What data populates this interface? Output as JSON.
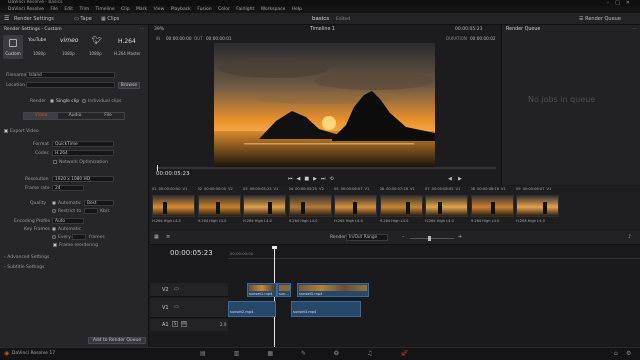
{
  "window": {
    "title": "DaVinci Resolve - basics"
  },
  "menu": [
    "DaVinci Resolve",
    "File",
    "Edit",
    "Trim",
    "Timeline",
    "Clip",
    "Mark",
    "View",
    "Playback",
    "Fusion",
    "Color",
    "Fairlight",
    "Workspace",
    "Help"
  ],
  "toolbar": {
    "render_settings": "Render Settings",
    "tape": "Tape",
    "clips": "Clips",
    "project_name": "basics",
    "project_status": "Edited",
    "render_queue": "Render Queue"
  },
  "render_settings": {
    "header": "Render Settings - Custom",
    "presets": [
      {
        "label": "Custom",
        "brand": ""
      },
      {
        "label": "1080p",
        "brand": "YouTube"
      },
      {
        "label": "1080p",
        "brand": "vimeo"
      },
      {
        "label": "1080p",
        "brand": "twitter"
      },
      {
        "label": "H.264 Master",
        "brand": "H.264"
      }
    ],
    "filename_label": "Filename",
    "filename_value": "Island",
    "location_label": "Location",
    "browse": "Browse",
    "render_label": "Render",
    "single_clip": "Single clip",
    "individual_clips": "Individual clips",
    "tabs": [
      "Video",
      "Audio",
      "File"
    ],
    "export_video": "Export Video",
    "format_label": "Format",
    "format_value": "QuickTime",
    "codec_label": "Codec",
    "codec_value": "H.264",
    "network_opt": "Network Optimization",
    "resolution_label": "Resolution",
    "resolution_value": "1920 x 1080 HD",
    "framerate_label": "Frame rate",
    "framerate_value": "24",
    "quality_label": "Quality",
    "automatic": "Automatic",
    "best": "Best",
    "restrict_to": "Restrict to",
    "kbs": "Kb/s",
    "encoding_profile_label": "Encoding Profile",
    "encoding_profile_value": "Auto",
    "key_frames_label": "Key Frames",
    "key_automatic": "Automatic",
    "every": "Every",
    "frames": "frames",
    "frame_reordering": "Frame reordering",
    "advanced_settings": "Advanced Settings",
    "subtitle_settings": "Subtitle Settings",
    "add_to_queue": "Add to Render Queue"
  },
  "viewer": {
    "zoom": "39%",
    "in_label": "IN",
    "in_tc": "00:00:00:00",
    "out_label": "OUT",
    "out_tc": "00:00:00:01",
    "timeline_name": "Timeline 1",
    "tc_right": "00:00:05:23",
    "duration_label": "DURATION",
    "duration_tc": "00:00:00:02",
    "playhead_tc": "00:00:05:23"
  },
  "render_queue": {
    "header": "Render Queue",
    "empty": "No jobs in queue"
  },
  "clip_strip": [
    {
      "num": "01",
      "tc": "00:00:00:00",
      "track": "V1",
      "codec": "H.264 High L4.0"
    },
    {
      "num": "02",
      "tc": "00:00:00:00",
      "track": "V2",
      "codec": "H.264 High L4.0"
    },
    {
      "num": "03",
      "tc": "00:00:05:23",
      "track": "V1",
      "codec": "H.264 High L4.0"
    },
    {
      "num": "04",
      "tc": "00:00:03:20",
      "track": "V2",
      "codec": "H.264 High L4.0"
    },
    {
      "num": "05",
      "tc": "00:00:06:07",
      "track": "V1",
      "codec": "H.264 High L4.0"
    },
    {
      "num": "06",
      "tc": "00:00:07:18",
      "track": "V1",
      "codec": "H.264 High L4.0"
    },
    {
      "num": "07",
      "tc": "00:00:08:05",
      "track": "V1",
      "codec": "H.264 High L4.0"
    },
    {
      "num": "08",
      "tc": "00:00:08:18",
      "track": "V1",
      "codec": "H.264 High L4.0"
    },
    {
      "num": "09",
      "tc": "00:00:06:07",
      "track": "V1",
      "codec": "H.264 High L4.0"
    }
  ],
  "timeline": {
    "timecode": "00:00:05:23",
    "render_label": "Render",
    "render_range": "In/Out Range",
    "ruler_start": "00:00:00:00",
    "tracks": [
      {
        "name": "V2"
      },
      {
        "name": "V1"
      },
      {
        "name": "A1",
        "value": "2.0"
      }
    ],
    "clips": {
      "v2_a": "sunset1.mp4",
      "v2_b": "sun...",
      "v2_c": "sunset5.mp4",
      "v1_a": "sunset2.mp4",
      "v1_b": "sunset3.mp4"
    }
  },
  "bottom": {
    "app_name": "DaVinci Resolve 17"
  },
  "colors": {
    "accent": "#e0491f",
    "clip_blue": "#26486b",
    "panel": "#25252a"
  }
}
